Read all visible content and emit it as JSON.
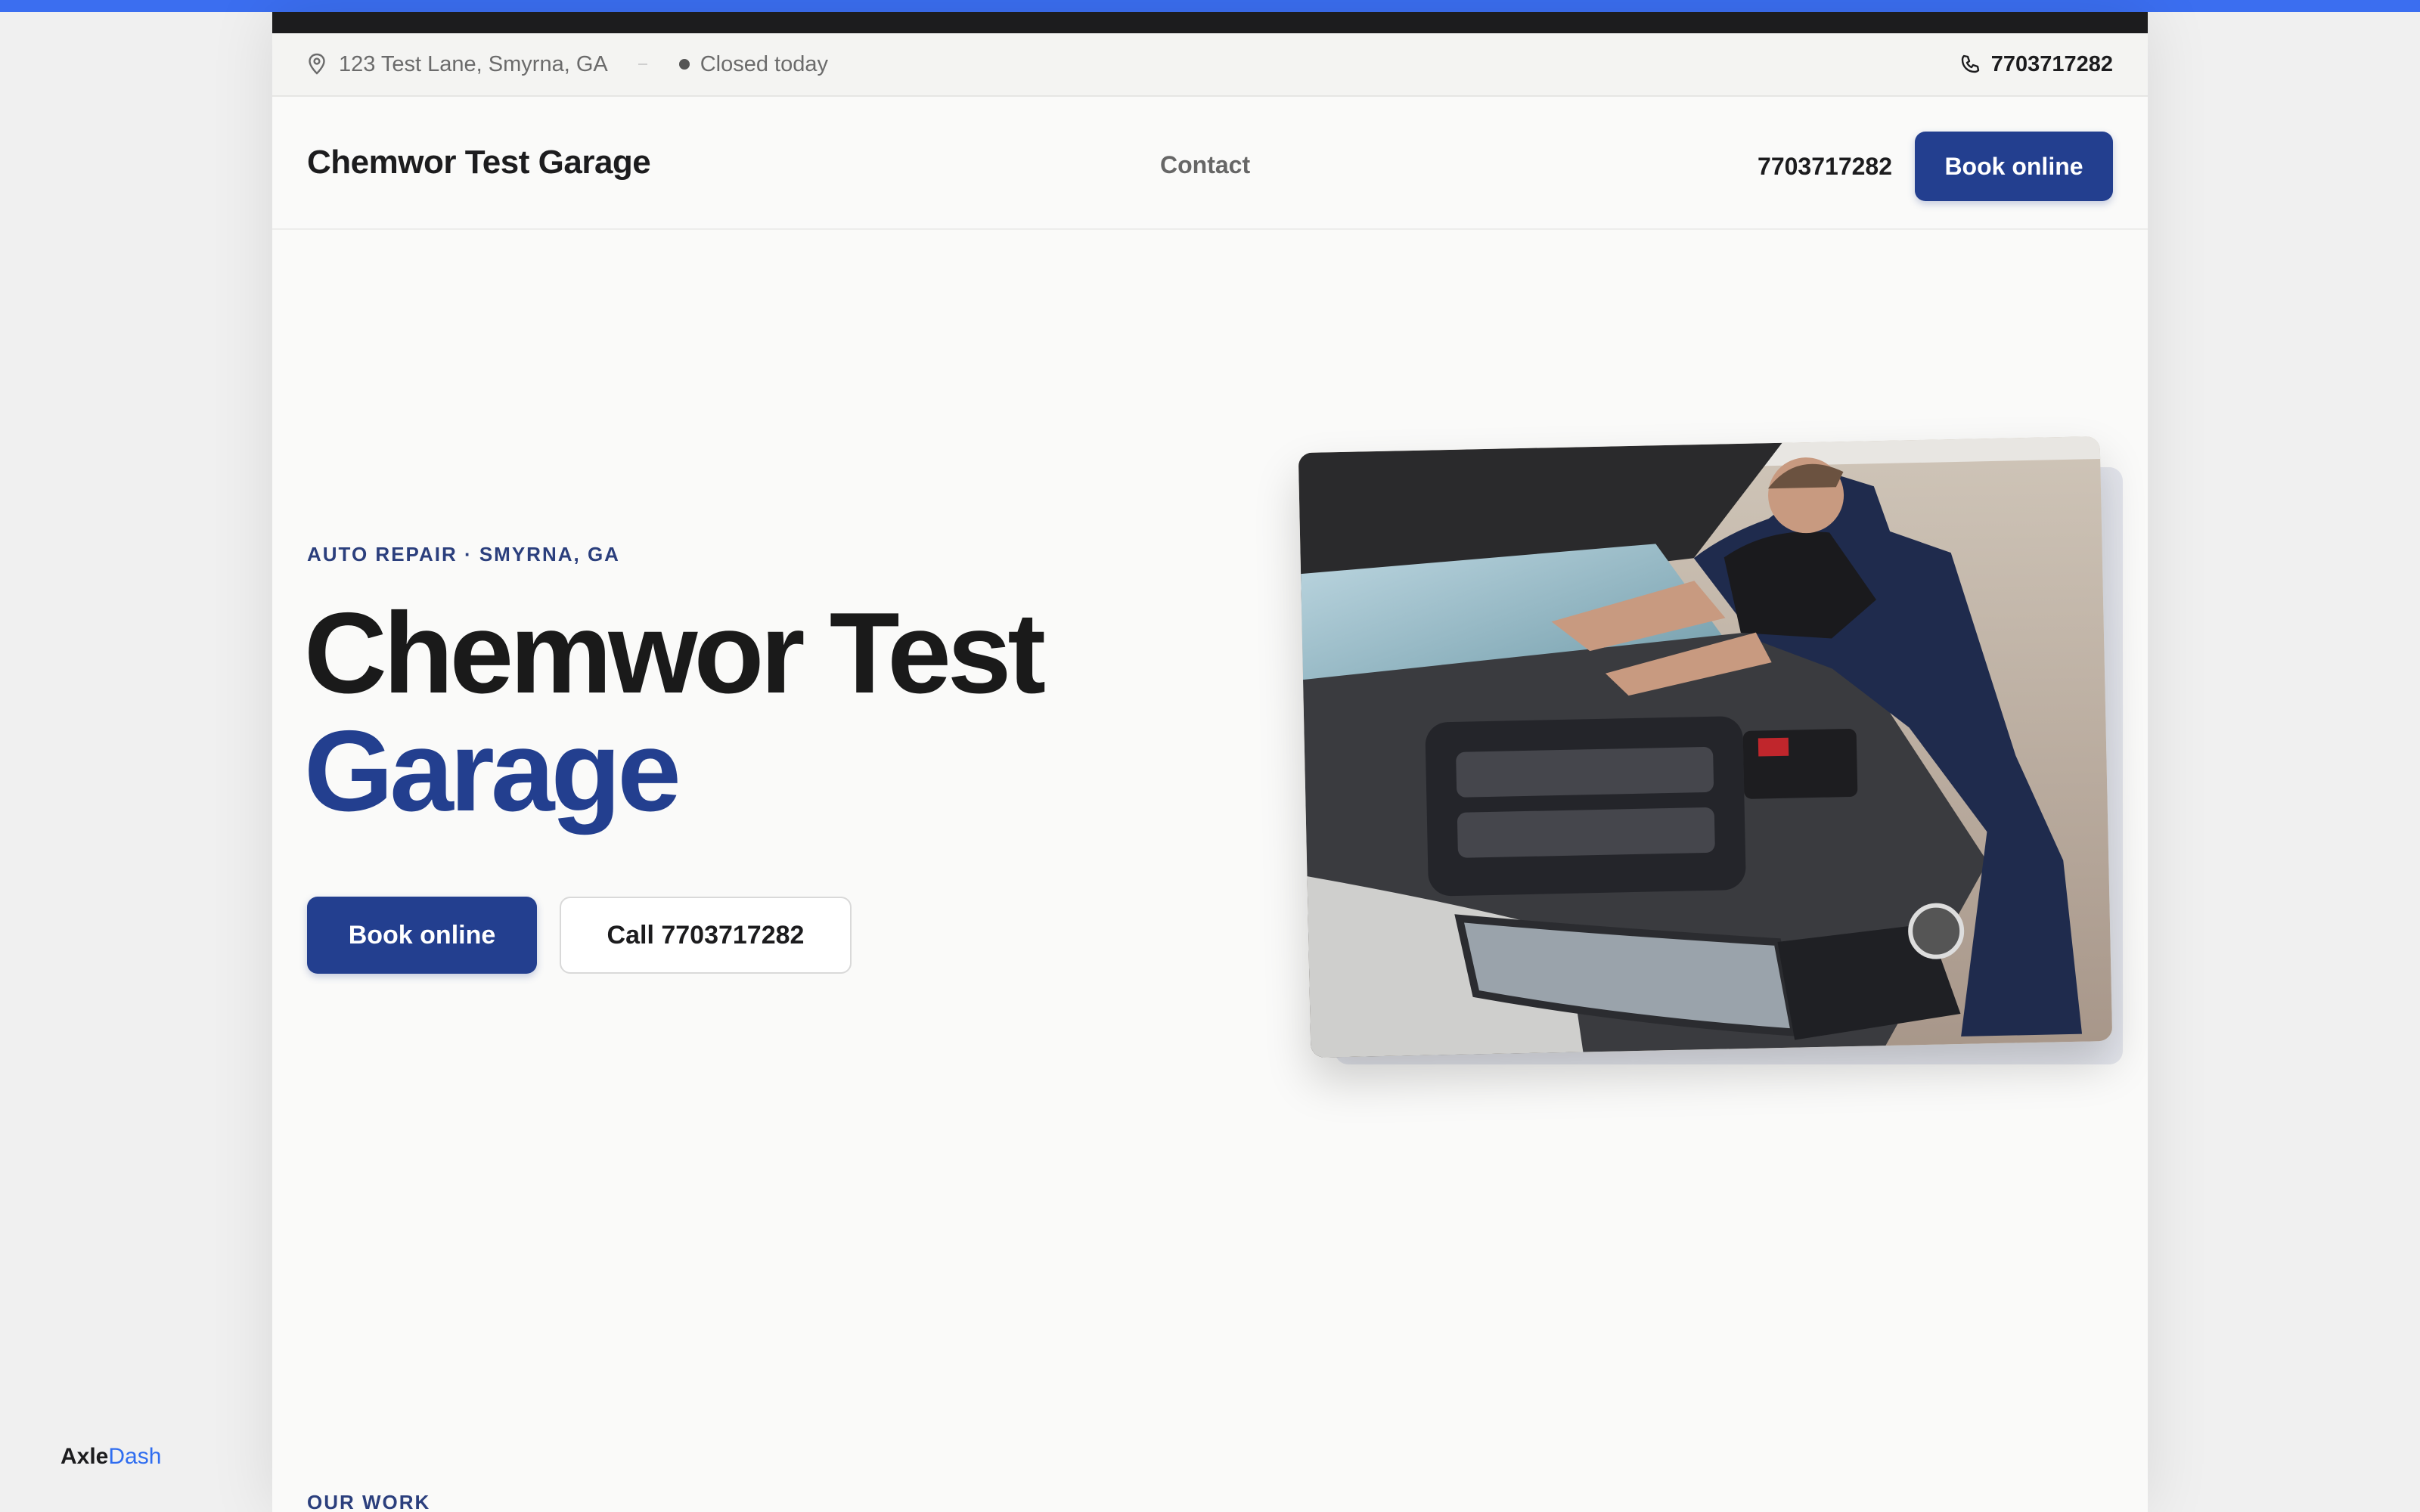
{
  "utility_bar": {
    "address": "123 Test Lane, Smyrna, GA",
    "status": "Closed today",
    "phone": "7703717282",
    "address_icon": "map-pin-icon",
    "phone_icon": "phone-icon"
  },
  "navbar": {
    "brand": "Chemwor Test Garage",
    "links": [
      "Contact"
    ],
    "phone": "7703717282",
    "cta_label": "Book online"
  },
  "hero": {
    "kicker": "AUTO REPAIR · SMYRNA, GA",
    "title_line1": "Chemwor Test",
    "title_line2": "Garage",
    "primary_cta": "Book online",
    "secondary_cta": "Call 7703717282",
    "image_subject": "mechanic working on car engine"
  },
  "next_section": {
    "kicker": "OUR WORK"
  },
  "footer_brand": {
    "part1": "Axle",
    "part2": "Dash"
  },
  "colors": {
    "accent": "#233f8f",
    "top_accent": "#3b6ef0",
    "brand_dash": "#2f6df0",
    "dark_strip": "#1c1c1e"
  }
}
